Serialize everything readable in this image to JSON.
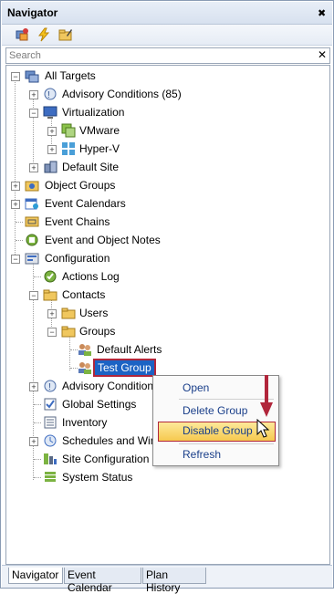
{
  "window": {
    "title": "Navigator",
    "pin_icon": "pin-close-icon"
  },
  "toolbar": {
    "icons": [
      "targets-icon",
      "lightning-icon",
      "folder-edit-icon"
    ]
  },
  "search": {
    "placeholder": "Search",
    "clear_icon": "close-icon"
  },
  "tree": {
    "all_targets": "All Targets",
    "advisory_conditions": "Advisory Conditions (85)",
    "virtualization": "Virtualization",
    "vmware": "VMware",
    "hyperv": "Hyper-V",
    "default_site": "Default Site",
    "object_groups": "Object Groups",
    "event_calendars": "Event Calendars",
    "event_chains": "Event Chains",
    "event_object_notes": "Event and Object Notes",
    "configuration": "Configuration",
    "actions_log": "Actions Log",
    "contacts": "Contacts",
    "users": "Users",
    "groups": "Groups",
    "default_alerts": "Default Alerts",
    "test_group": "Test Group",
    "advisory_conditions_cfg": "Advisory Condition",
    "global_settings": "Global Settings",
    "inventory": "Inventory",
    "schedules": "Schedules and Win",
    "site_configuration": "Site Configuration",
    "system_status": "System Status"
  },
  "context_menu": {
    "open": "Open",
    "delete_group": "Delete Group",
    "disable_group": "Disable Group",
    "refresh": "Refresh"
  },
  "tabs": {
    "navigator": "Navigator",
    "event_calendar": "Event Calendar",
    "plan_history": "Plan History"
  },
  "colors": {
    "selection": "#1c63c4",
    "highlight_border": "#b1263b",
    "menu_highlight": "#f6c94f"
  }
}
